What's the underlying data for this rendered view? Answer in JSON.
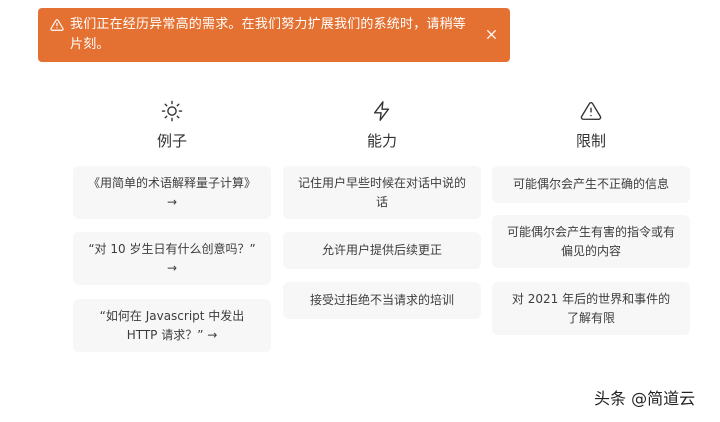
{
  "alert": {
    "message": "我们正在经历异常高的需求。在我们努力扩展我们的系统时，请稍等片刻。",
    "icon": "warning-icon",
    "close_icon": "close-icon",
    "background": "#e47131"
  },
  "columns": [
    {
      "title": "例子",
      "icon": "sun-icon",
      "cards": [
        "《用简单的术语解释量子计算》 →",
        "“对 10 岁生日有什么创意吗？” →",
        "“如何在 Javascript 中发出 HTTP 请求？” →"
      ]
    },
    {
      "title": "能力",
      "icon": "lightning-icon",
      "cards": [
        "记住用户早些时候在对话中说的话",
        "允许用户提供后续更正",
        "接受过拒绝不当请求的培训"
      ]
    },
    {
      "title": "限制",
      "icon": "warning-triangle-icon",
      "cards": [
        "可能偶尔会产生不正确的信息",
        "可能偶尔会产生有害的指令或有偏见的内容",
        "对 2021 年后的世界和事件的了解有限"
      ]
    }
  ],
  "watermark": "头条 @简道云"
}
